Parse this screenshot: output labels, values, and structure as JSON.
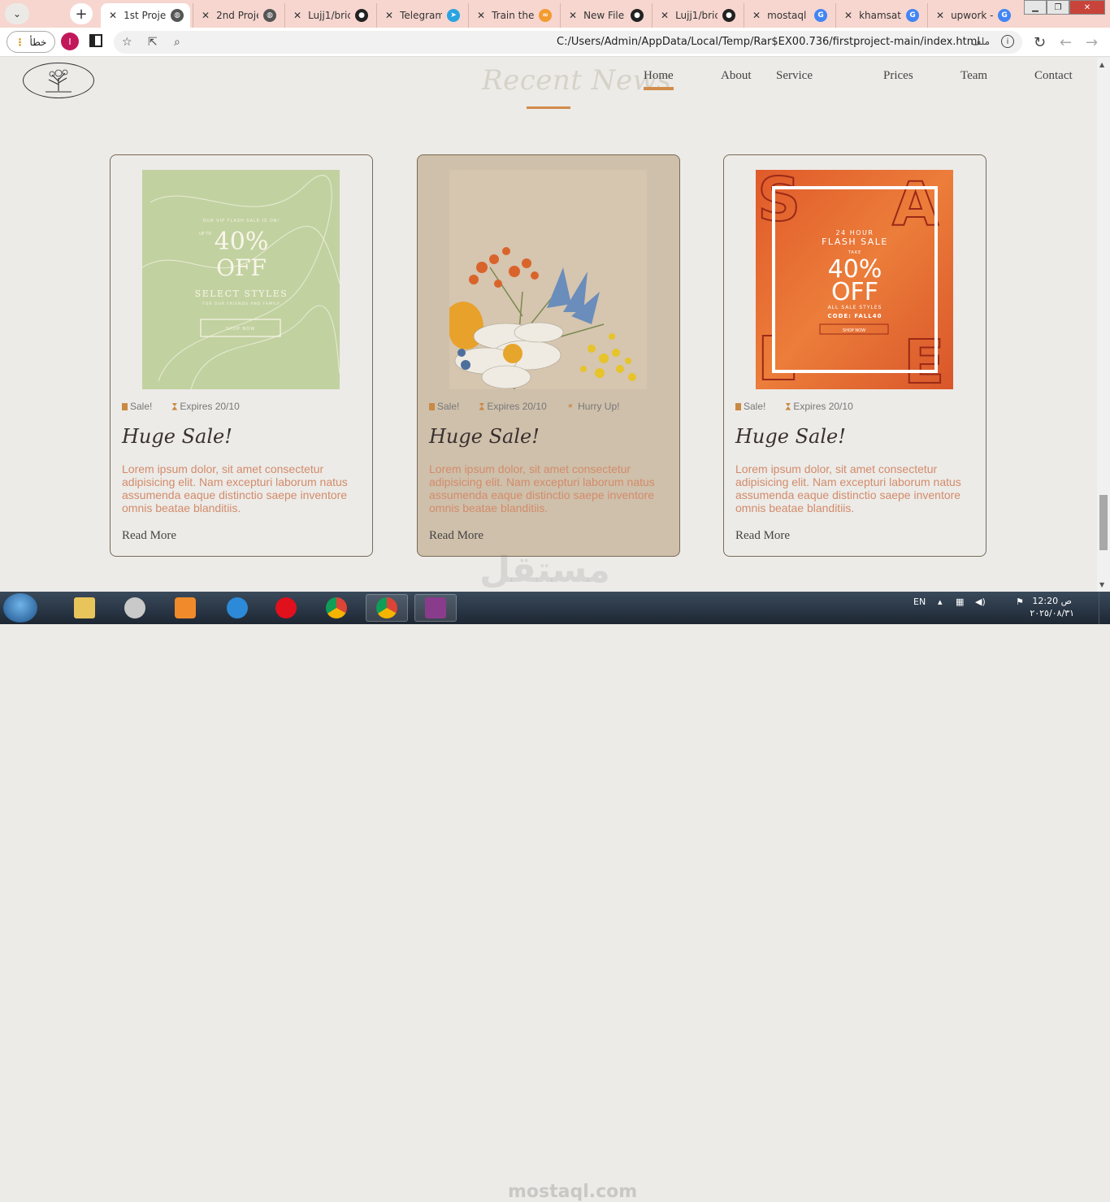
{
  "browser": {
    "tabs": [
      {
        "label": "1st Proje",
        "icon": "globe-icon",
        "color": "#555555",
        "active": true
      },
      {
        "label": "2nd Proje",
        "icon": "globe-icon",
        "color": "#555555"
      },
      {
        "label": "Lujj1/bric",
        "icon": "github-icon",
        "color": "#222222"
      },
      {
        "label": "Telegram",
        "icon": "telegram-icon",
        "color": "#2aa3e0"
      },
      {
        "label": "Train the",
        "icon": "colab-icon",
        "color": "#f29b2f"
      },
      {
        "label": "New File",
        "icon": "github-icon",
        "color": "#222222"
      },
      {
        "label": "Lujj1/bric",
        "icon": "github-icon",
        "color": "#222222"
      },
      {
        "label": "mostaql",
        "icon": "google-icon",
        "color": "#4285f4"
      },
      {
        "label": "khamsat",
        "icon": "google-icon",
        "color": "#4285f4"
      },
      {
        "label": "upwork -",
        "icon": "google-icon",
        "color": "#4285f4"
      }
    ],
    "error_label": "خطأ",
    "profile_initial": "I",
    "url": "C:/Users/Admin/AppData/Local/Temp/Rar$EX00.736/firstproject-main/index.html",
    "file_label": "ملف"
  },
  "site": {
    "section_title": "Recent News",
    "nav": [
      "Home",
      "About",
      "Service",
      "Prices",
      "Team",
      "Contact"
    ],
    "active_nav": "Home",
    "cards": [
      {
        "image": "sale-green",
        "meta": [
          "Sale!",
          "Expires 20/10"
        ],
        "title": "Huge Sale!",
        "text": "Lorem ipsum dolor, sit amet consectetur adipisicing elit. Nam excepturi laborum natus assumenda eaque distinctio saepe inventore omnis beatae blanditiis.",
        "link": "Read More"
      },
      {
        "image": "flowers",
        "meta": [
          "Sale!",
          "Expires 20/10",
          "Hurry Up!"
        ],
        "title": "Huge Sale!",
        "text": "Lorem ipsum dolor, sit amet consectetur adipisicing elit. Nam excepturi laborum natus assumenda eaque distinctio saepe inventore omnis beatae blanditiis.",
        "link": "Read More"
      },
      {
        "image": "sale-orange",
        "meta": [
          "Sale!",
          "Expires 20/10"
        ],
        "title": "Huge Sale!",
        "text": "Lorem ipsum dolor, sit amet consectetur adipisicing elit. Nam excepturi laborum natus assumenda eaque distinctio saepe inventore omnis beatae blanditiis.",
        "link": "Read More"
      }
    ],
    "promo_green": {
      "line1": "OUR VIP FLASH SALE IS ON!",
      "up_to": "UP TO",
      "pct": "40%",
      "off": "OFF",
      "select": "SELECT STYLES",
      "sub": "FOR OUR FRIENDS AND FAMILY",
      "btn": "SHOP NOW"
    },
    "promo_orange": {
      "hour": "24 HOUR",
      "flash": "FLASH SALE",
      "take": "TAKE",
      "pct": "40%",
      "off": "OFF",
      "all": "ALL SALE STYLES",
      "code": "CODE: FALL40",
      "btn": "SHOP NOW",
      "letters": [
        "S",
        "A",
        "L",
        "E"
      ]
    }
  },
  "taskbar": {
    "lang": "EN",
    "time": "12:20 ص",
    "date": "٢٠٢٥/٠٨/٣١",
    "watermark": "مستقل",
    "watermark_sub": "mostaql.com"
  },
  "colors": {
    "accent": "#d38b4a",
    "text_body": "#d38b6a",
    "card_featured": "#cfc0ab"
  }
}
